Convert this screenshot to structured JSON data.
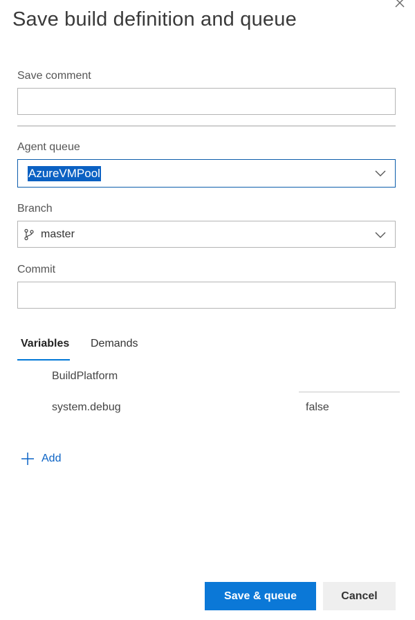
{
  "dialog": {
    "title": "Save build definition and queue"
  },
  "form": {
    "save_comment": {
      "label": "Save comment",
      "value": "",
      "placeholder": ""
    },
    "agent_queue": {
      "label": "Agent queue",
      "selected": "AzureVMPool"
    },
    "branch": {
      "label": "Branch",
      "selected": "master"
    },
    "commit": {
      "label": "Commit",
      "value": "",
      "placeholder": ""
    }
  },
  "tabs": [
    {
      "label": "Variables",
      "active": true
    },
    {
      "label": "Demands",
      "active": false
    }
  ],
  "variables": [
    {
      "name": "BuildPlatform",
      "value": ""
    },
    {
      "name": "system.debug",
      "value": "false"
    }
  ],
  "add": {
    "label": "Add"
  },
  "buttons": {
    "primary": "Save & queue",
    "secondary": "Cancel"
  },
  "colors": {
    "accent": "#0078d7",
    "selection": "#0b61c3",
    "link": "#0b63c5"
  },
  "icons": {
    "close": "close-icon",
    "chevron": "chevron-down-icon",
    "branch": "git-branch-icon",
    "add": "plus-icon"
  }
}
